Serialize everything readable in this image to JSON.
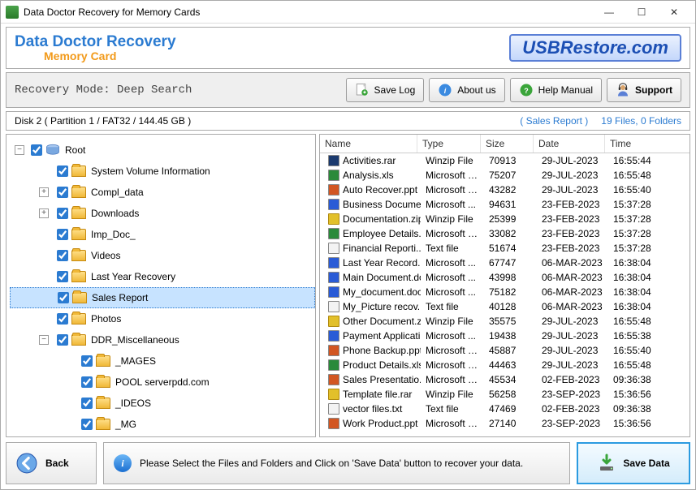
{
  "window": {
    "title": "Data Doctor Recovery for Memory Cards"
  },
  "brand": {
    "line1": "Data Doctor Recovery",
    "line2": "Memory Card",
    "site": "USBRestore.com"
  },
  "toolbar": {
    "mode_label": "Recovery Mode: Deep Search",
    "save_log": "Save Log",
    "about": "About us",
    "help": "Help Manual",
    "support": "Support"
  },
  "diskbar": {
    "disk": "Disk 2 ( Partition 1 / FAT32 / 144.45 GB )",
    "selection": "( Sales Report )",
    "stats": "19 Files, 0 Folders"
  },
  "tree": [
    {
      "depth": 0,
      "exp": "-",
      "label": "Root",
      "icon": "drive"
    },
    {
      "depth": 1,
      "exp": "",
      "label": "System Volume Information"
    },
    {
      "depth": 1,
      "exp": "+",
      "label": "Compl_data"
    },
    {
      "depth": 1,
      "exp": "+",
      "label": "Downloads"
    },
    {
      "depth": 1,
      "exp": "",
      "label": "Imp_Doc_"
    },
    {
      "depth": 1,
      "exp": "",
      "label": "Videos"
    },
    {
      "depth": 1,
      "exp": "",
      "label": "Last Year Recovery"
    },
    {
      "depth": 1,
      "exp": "",
      "label": "Sales Report",
      "selected": true
    },
    {
      "depth": 1,
      "exp": "",
      "label": "Photos"
    },
    {
      "depth": 1,
      "exp": "-",
      "label": "DDR_Miscellaneous"
    },
    {
      "depth": 2,
      "exp": "",
      "label": "_MAGES"
    },
    {
      "depth": 2,
      "exp": "",
      "label": "POOL serverpdd.com"
    },
    {
      "depth": 2,
      "exp": "",
      "label": "_IDEOS"
    },
    {
      "depth": 2,
      "exp": "",
      "label": "_MG"
    }
  ],
  "columns": {
    "name": "Name",
    "type": "Type",
    "size": "Size",
    "date": "Date",
    "time": "Time"
  },
  "files": [
    {
      "icon": "ps",
      "name": "Activities.rar",
      "type": "Winzip File",
      "size": "70913",
      "date": "29-JUL-2023",
      "time": "16:55:44"
    },
    {
      "icon": "xls",
      "name": "Analysis.xls",
      "type": "Microsoft E...",
      "size": "75207",
      "date": "29-JUL-2023",
      "time": "16:55:48"
    },
    {
      "icon": "ppt",
      "name": "Auto Recover.ppt",
      "type": "Microsoft P...",
      "size": "43282",
      "date": "29-JUL-2023",
      "time": "16:55:40"
    },
    {
      "icon": "doc",
      "name": "Business Docume...",
      "type": "Microsoft ...",
      "size": "94631",
      "date": "23-FEB-2023",
      "time": "15:37:28"
    },
    {
      "icon": "zip",
      "name": "Documentation.zip",
      "type": "Winzip File",
      "size": "25399",
      "date": "23-FEB-2023",
      "time": "15:37:28"
    },
    {
      "icon": "xls",
      "name": "Employee Details...",
      "type": "Microsoft E...",
      "size": "33082",
      "date": "23-FEB-2023",
      "time": "15:37:28"
    },
    {
      "icon": "txt",
      "name": "Financial Reporti...",
      "type": "Text file",
      "size": "51674",
      "date": "23-FEB-2023",
      "time": "15:37:28"
    },
    {
      "icon": "doc",
      "name": "Last Year Record...",
      "type": "Microsoft ...",
      "size": "67747",
      "date": "06-MAR-2023",
      "time": "16:38:04"
    },
    {
      "icon": "doc",
      "name": "Main Document.doc",
      "type": "Microsoft ...",
      "size": "43998",
      "date": "06-MAR-2023",
      "time": "16:38:04"
    },
    {
      "icon": "doc",
      "name": "My_document.doc",
      "type": "Microsoft ...",
      "size": "75182",
      "date": "06-MAR-2023",
      "time": "16:38:04"
    },
    {
      "icon": "txt",
      "name": "My_Picture recov...",
      "type": "Text file",
      "size": "40128",
      "date": "06-MAR-2023",
      "time": "16:38:04"
    },
    {
      "icon": "zip",
      "name": "Other Document.zip",
      "type": "Winzip File",
      "size": "35575",
      "date": "29-JUL-2023",
      "time": "16:55:48"
    },
    {
      "icon": "doc",
      "name": "Payment Applicati...",
      "type": "Microsoft ...",
      "size": "19438",
      "date": "29-JUL-2023",
      "time": "16:55:38"
    },
    {
      "icon": "ppt",
      "name": "Phone Backup.ppt",
      "type": "Microsoft P...",
      "size": "45887",
      "date": "29-JUL-2023",
      "time": "16:55:40"
    },
    {
      "icon": "xls",
      "name": "Product Details.xls",
      "type": "Microsoft E...",
      "size": "44463",
      "date": "29-JUL-2023",
      "time": "16:55:48"
    },
    {
      "icon": "ppt",
      "name": "Sales Presentatio...",
      "type": "Microsoft P...",
      "size": "45534",
      "date": "02-FEB-2023",
      "time": "09:36:38"
    },
    {
      "icon": "zip",
      "name": "Template file.rar",
      "type": "Winzip File",
      "size": "56258",
      "date": "23-SEP-2023",
      "time": "15:36:56"
    },
    {
      "icon": "txt",
      "name": "vector files.txt",
      "type": "Text file",
      "size": "47469",
      "date": "02-FEB-2023",
      "time": "09:36:38"
    },
    {
      "icon": "ppt",
      "name": "Work Product.ppt",
      "type": "Microsoft P...",
      "size": "27140",
      "date": "23-SEP-2023",
      "time": "15:36:56"
    }
  ],
  "bottom": {
    "back": "Back",
    "hint": "Please Select the Files and Folders and Click on 'Save Data' button to recover your data.",
    "save": "Save Data"
  }
}
